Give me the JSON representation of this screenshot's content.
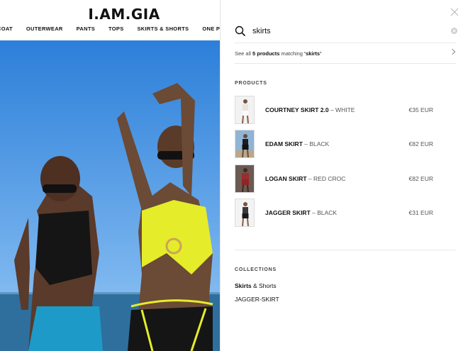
{
  "site": {
    "logo": "I.AM.GIA",
    "nav": [
      "COAT",
      "OUTERWEAR",
      "PANTS",
      "TOPS",
      "SKIRTS & SHORTS",
      "ONE PIECES"
    ]
  },
  "search": {
    "query": "skirts",
    "see_all": {
      "prefix": "See all ",
      "count": "5 products",
      "middle": " matching ",
      "term": "‘skirts’"
    }
  },
  "products": {
    "title": "PRODUCTS",
    "items": [
      {
        "name": "COURTNEY SKIRT 2.0",
        "color": " – WHITE",
        "price": "€35 EUR"
      },
      {
        "name": "EDAM SKIRT",
        "color": " – BLACK",
        "price": "€82 EUR"
      },
      {
        "name": "LOGAN SKIRT",
        "color": " – RED CROC",
        "price": "€82 EUR"
      },
      {
        "name": "JAGGER SKIRT",
        "color": " – BLACK",
        "price": "€31 EUR"
      }
    ]
  },
  "collections": {
    "title": "COLLECTIONS",
    "items": [
      {
        "bold": "Skirts",
        "rest": " & Shorts"
      },
      {
        "bold": "",
        "rest": "JAGGER-SKIRT"
      }
    ]
  },
  "icons": {
    "search": "search-icon",
    "clear": "clear-icon",
    "close": "close-icon",
    "chevron": "chevron-right-icon"
  }
}
